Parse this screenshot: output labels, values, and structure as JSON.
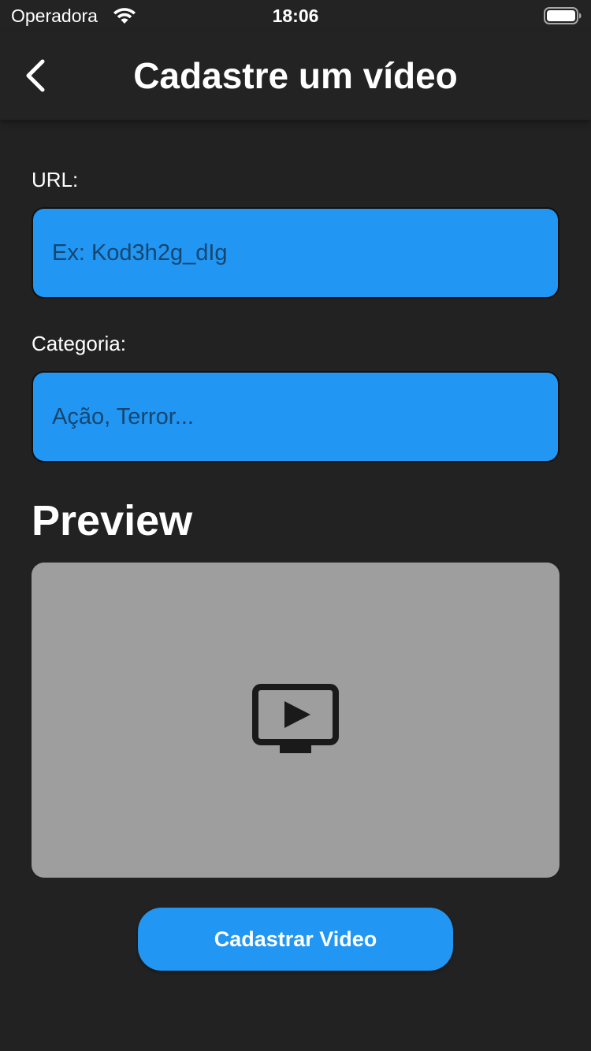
{
  "status_bar": {
    "carrier": "Operadora",
    "time": "18:06",
    "wifi_icon": "wifi-icon",
    "battery_icon": "battery-icon"
  },
  "nav": {
    "back_icon": "chevron-left-icon",
    "title": "Cadastre um vídeo"
  },
  "form": {
    "url_label": "URL:",
    "url_placeholder": "Ex: Kod3h2g_dIg",
    "url_value": "",
    "category_label": "Categoria:",
    "category_placeholder": "Ação, Terror...",
    "category_value": ""
  },
  "preview": {
    "heading": "Preview",
    "icon": "ondemand-video-icon"
  },
  "actions": {
    "submit_label": "Cadastrar Video"
  },
  "colors": {
    "background": "#222222",
    "accent": "#2196f3",
    "preview_bg": "#9e9e9e",
    "text": "#ffffff"
  }
}
